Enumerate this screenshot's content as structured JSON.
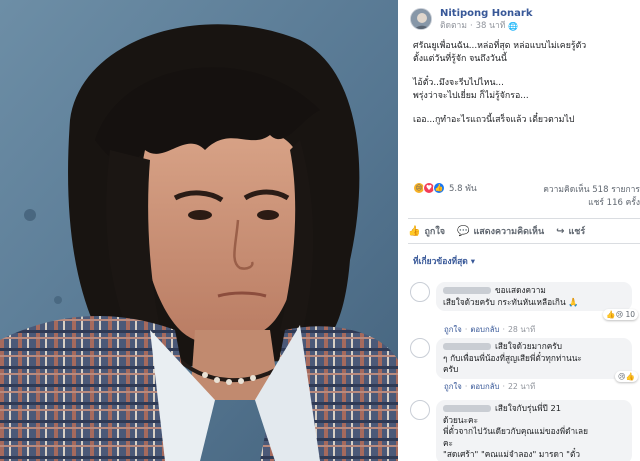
{
  "post": {
    "author": "Nitipong Honark",
    "follow_label": "ติดตาม",
    "time": "38 นาที",
    "paragraphs": [
      [
        "ศรัณยูเพื่อนฉัน...หล่อที่สุด หล่อแบบไม่เคยรู้ตัว",
        "ตั้งแต่วันที่รู้จัก จนถึงวันนี้"
      ],
      [
        "ไอ้ตั๋ว..มึงจะรีบไปไหน...",
        "พรุ่งว่าจะไปเยี่ยม ก็ไม่รู้จักรอ..."
      ],
      [
        "เออ...กูทำอะไรแถวนี้เสร็จแล้ว เดี๋ยวตามไป"
      ]
    ]
  },
  "stats": {
    "reactions": "5.8 พัน",
    "comments": "ความคิดเห็น 518 รายการ",
    "shares": "แชร์ 116 ครั้ง"
  },
  "actions": {
    "like": "ถูกใจ",
    "comment": "แสดงความคิดเห็น",
    "share": "แชร์"
  },
  "relevant_label": "ที่เกี่ยวข้องที่สุด ▾",
  "comments": [
    {
      "lines": [
        "ขอแสดงความ",
        "เสียใจด้วยครับ กระทันหันเหลือเกิน 🙏"
      ],
      "reaction_count": "10",
      "like": "ถูกใจ",
      "reply": "ตอบกลับ",
      "time": "28 นาที"
    },
    {
      "lines": [
        "เสียใจด้วยมากครับ",
        "ๆ กับเพื่อนพี่น้องที่สูญเสียพี่ตั๋วทุกท่านนะ",
        "ครับ"
      ],
      "reaction_count": "",
      "like": "ถูกใจ",
      "reply": "ตอบกลับ",
      "time": "22 นาที"
    },
    {
      "lines": [
        "เสียใจกับรุ่นพี่ปี 21",
        "ด้วยนะคะ",
        "พี่ตั๋วจากไปวันเดียวกับคุณแม่ของพี่ดำเลย",
        "คะ",
        "\"สดเศร้า\" \"คณแม่จำลอง\" มารดา \"ตั๋ว"
      ],
      "reaction_count": "",
      "like": "",
      "reply": "",
      "time": ""
    }
  ],
  "colors": {
    "link": "#385898",
    "muted": "#90949c",
    "bubble": "#f2f3f5"
  }
}
